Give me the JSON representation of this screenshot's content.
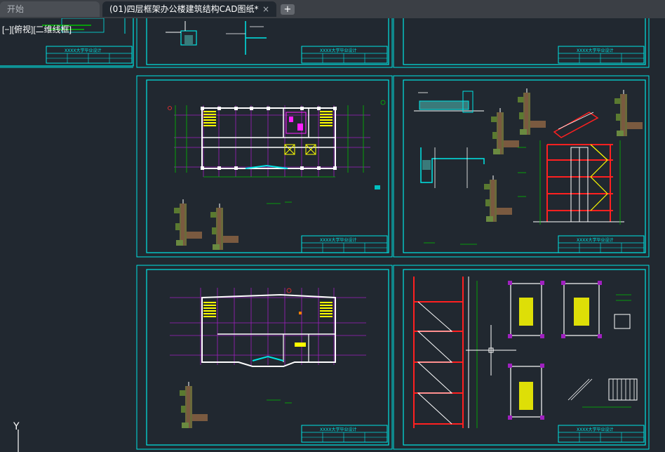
{
  "tabs": {
    "start_label": "开始",
    "document_label": "(01)四层框架办公楼建筑结构CAD图纸*",
    "close_glyph": "×",
    "add_glyph": "+"
  },
  "viewport": {
    "label": "[−][俯视][二维线框]"
  },
  "title_block": {
    "text": "XXXX大学毕业设计"
  },
  "ucs": {
    "y_label": "Y"
  },
  "colors": {
    "background": "#212830",
    "frame": "#00e5e5",
    "grid": "#a020c0",
    "wall": "#ffffff",
    "stair": "#ffff00",
    "accent": "#ff2020",
    "dimension": "#00c000"
  }
}
